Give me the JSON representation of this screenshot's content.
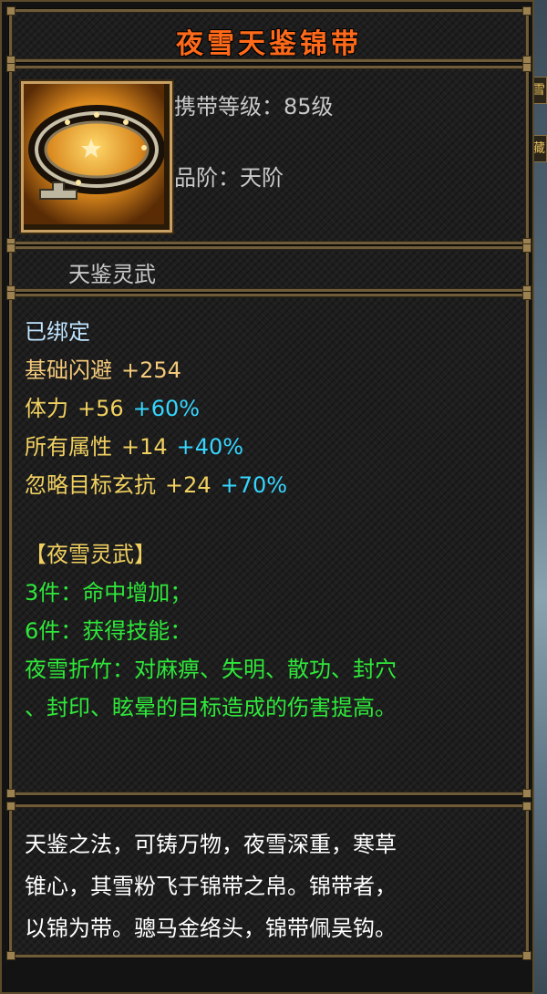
{
  "item": {
    "name": "夜雪天鉴锦带",
    "level_label": "携带等级：85级",
    "grade_label": "品阶：天阶",
    "subtitle": "天鉴灵武",
    "icon": "gold-belt-icon"
  },
  "stats": {
    "bound": "已绑定",
    "lines": [
      {
        "name": "基础闪避",
        "value": "+254",
        "percent": ""
      },
      {
        "name": "体力",
        "value": "+56",
        "percent": "+60%"
      },
      {
        "name": "所有属性",
        "value": "+14",
        "percent": "+40%"
      },
      {
        "name": "忽略目标玄抗",
        "value": "+24",
        "percent": "+70%"
      }
    ]
  },
  "set": {
    "title": "【夜雪灵武】",
    "bonus3": "3件：命中增加；",
    "bonus6": "6件：获得技能：",
    "skill_line1": "夜雪折竹：对麻痹、失明、散功、封穴",
    "skill_line2": "、封印、眩晕的目标造成的伤害提高。"
  },
  "description": {
    "lines": [
      "天鉴之法，可铸万物，夜雪深重，寒草",
      "锥心，其雪粉飞于锦带之帛。锦带者，",
      "以锦为带。骢马金络头，锦带佩吴钩。"
    ]
  },
  "background_tags": [
    "雪",
    "藏"
  ],
  "colors": {
    "title": "#ff6a1a",
    "bound": "#bfe4ff",
    "stat_name": "#f4c97a",
    "stat_percent": "#36d6ff",
    "set_bonus": "#2fe83a",
    "description": "#ffffff",
    "border": "#6e5b3a"
  }
}
